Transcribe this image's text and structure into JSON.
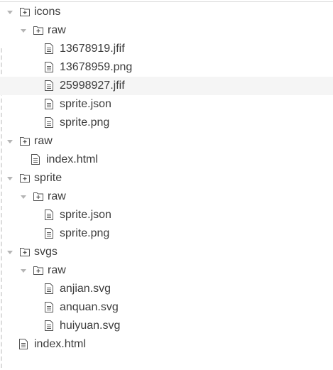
{
  "tree": [
    {
      "label": "icons",
      "type": "folder",
      "level": 0,
      "expanded": true
    },
    {
      "label": "raw",
      "type": "folder",
      "level": 1,
      "expanded": true
    },
    {
      "label": "13678919.jfif",
      "type": "file",
      "level": 2
    },
    {
      "label": "13678959.png",
      "type": "file",
      "level": 2
    },
    {
      "label": "25998927.jfif",
      "type": "file",
      "level": 2,
      "selected": true
    },
    {
      "label": "sprite.json",
      "type": "file",
      "level": 2
    },
    {
      "label": "sprite.png",
      "type": "file",
      "level": 2
    },
    {
      "label": "raw",
      "type": "folder",
      "level": 0,
      "expanded": true
    },
    {
      "label": "index.html",
      "type": "file",
      "level": 1
    },
    {
      "label": "sprite",
      "type": "folder",
      "level": 0,
      "expanded": true
    },
    {
      "label": "raw",
      "type": "folder",
      "level": 1,
      "expanded": true
    },
    {
      "label": "sprite.json",
      "type": "file",
      "level": 2
    },
    {
      "label": "sprite.png",
      "type": "file",
      "level": 2
    },
    {
      "label": "svgs",
      "type": "folder",
      "level": 0,
      "expanded": true
    },
    {
      "label": "raw",
      "type": "folder",
      "level": 1,
      "expanded": true
    },
    {
      "label": "anjian.svg",
      "type": "file",
      "level": 2
    },
    {
      "label": "anquan.svg",
      "type": "file",
      "level": 2
    },
    {
      "label": "huiyuan.svg",
      "type": "file",
      "level": 2
    },
    {
      "label": "index.html",
      "type": "file",
      "level": 0
    }
  ]
}
